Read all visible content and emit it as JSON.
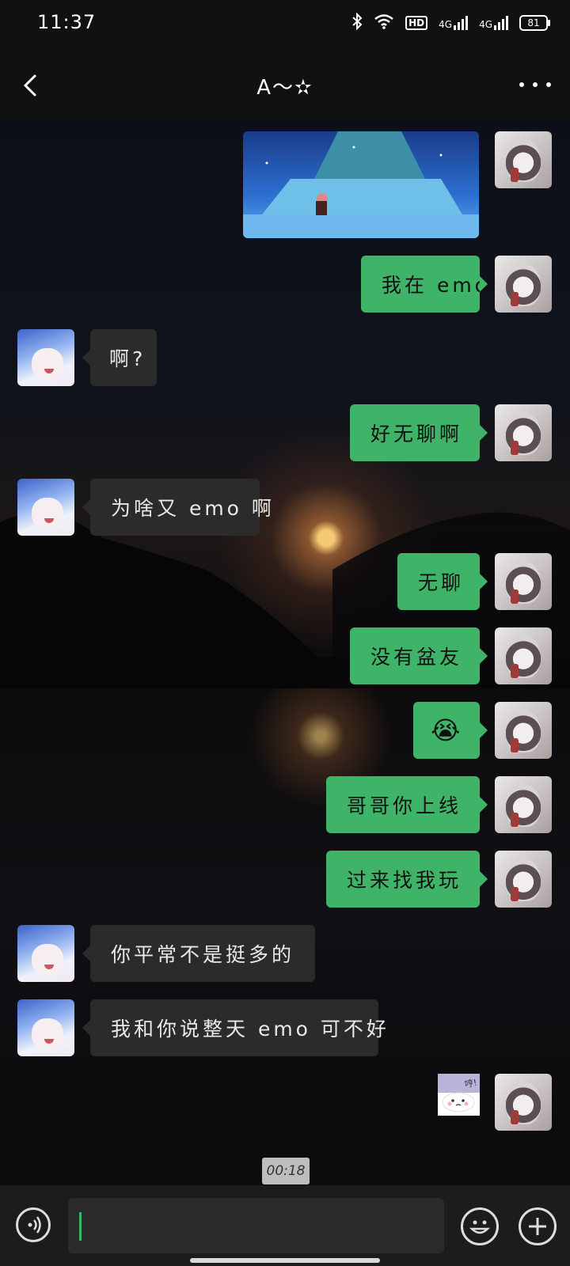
{
  "status_bar": {
    "time": "11:37",
    "battery": "81",
    "network_1": "4G",
    "network_2": "4G",
    "hd": "HD"
  },
  "header": {
    "title": "A～✫"
  },
  "messages": [
    {
      "side": "me",
      "type": "image"
    },
    {
      "side": "me",
      "text": "我在 emo"
    },
    {
      "side": "them",
      "text": "啊?"
    },
    {
      "side": "me",
      "text": "好无聊啊"
    },
    {
      "side": "them",
      "text": "为啥又 emo 啊"
    },
    {
      "side": "me",
      "text": "无聊"
    },
    {
      "side": "me",
      "text": "没有盆友"
    },
    {
      "side": "me",
      "text": "😭",
      "type": "emoji"
    },
    {
      "side": "me",
      "text": "哥哥你上线"
    },
    {
      "side": "me",
      "text": "过来找我玩"
    },
    {
      "side": "them",
      "text": "你平常不是挺多的"
    },
    {
      "side": "them",
      "text": "我和你说整天 emo 可不好"
    },
    {
      "side": "me",
      "type": "sticker",
      "text": "哼!"
    }
  ],
  "voice_timestamp": "00:18",
  "input": {
    "value": "",
    "placeholder": ""
  },
  "colors": {
    "my_bubble": "#3fb468",
    "their_bubble": "#2b2b2b",
    "bar_bg": "#111111"
  },
  "icons": {
    "back": "chevron-left-icon",
    "more": "more-dots-icon",
    "voice": "voice-icon",
    "emoji": "emoji-icon",
    "plus": "plus-icon"
  }
}
